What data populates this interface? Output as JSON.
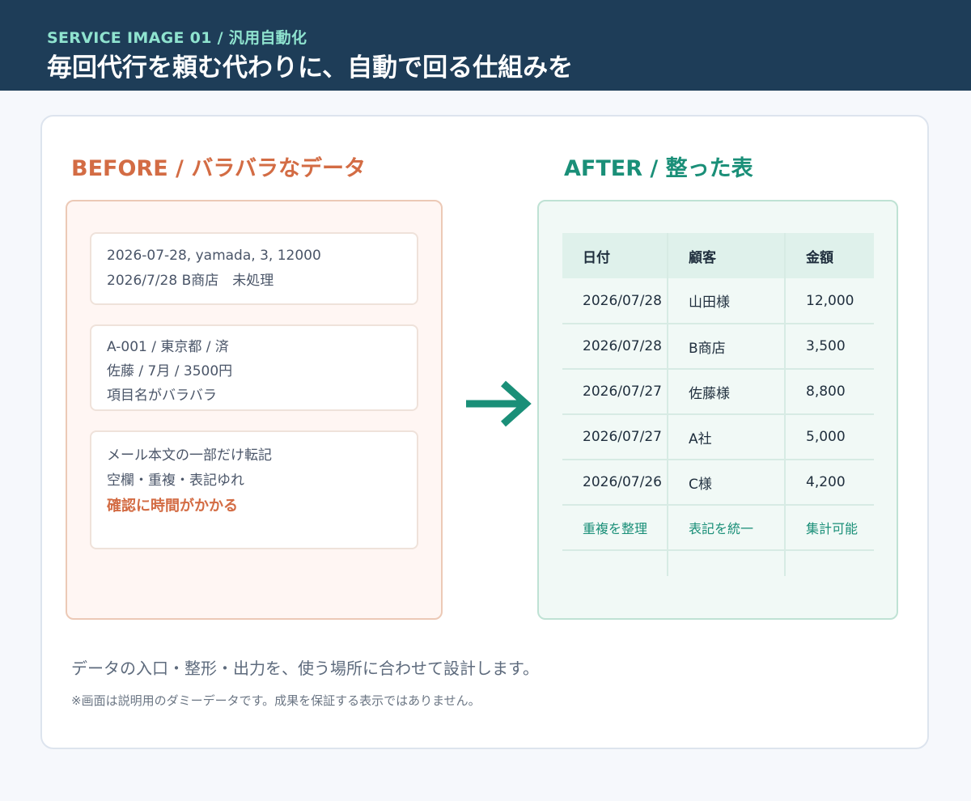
{
  "header": {
    "eyebrow": "SERVICE IMAGE 01  /  汎用自動化",
    "title": "毎回代行を頼む代わりに、自動で回る仕組みを"
  },
  "before": {
    "title": "BEFORE  /  バラバラなデータ",
    "notes": [
      {
        "lines": [
          "2026-07-28, yamada, 3, 12000",
          "2026/7/28  B商店　未処理"
        ]
      },
      {
        "lines": [
          "A-001 / 東京都 / 済",
          "佐藤 / 7月 / 3500円",
          "項目名がバラバラ"
        ]
      },
      {
        "lines": [
          "メール本文の一部だけ転記",
          "空欄・重複・表記ゆれ"
        ],
        "emphasis": "確認に時間がかかる"
      }
    ]
  },
  "after": {
    "title": "AFTER  /  整った表",
    "columns": [
      "日付",
      "顧客",
      "金額"
    ],
    "rows": [
      [
        "2026/07/28",
        "山田様",
        "12,000"
      ],
      [
        "2026/07/28",
        "B商店",
        "3,500"
      ],
      [
        "2026/07/27",
        "佐藤様",
        "8,800"
      ],
      [
        "2026/07/27",
        "A社",
        "5,000"
      ],
      [
        "2026/07/26",
        "C様",
        "4,200"
      ]
    ],
    "footer": [
      "重複を整理",
      "表記を統一",
      "集計可能"
    ]
  },
  "caption": "データの入口・整形・出力を、使う場所に合わせて設計します。",
  "disclaimer": "※画面は説明用のダミーデータです。成果を保証する表示ではありません。",
  "colors": {
    "header_bg": "#1e3d58",
    "eyebrow": "#8fe3cf",
    "before_accent": "#d36c44",
    "after_accent": "#1a8f78"
  },
  "icons": {
    "transition": "arrow-right-icon"
  }
}
